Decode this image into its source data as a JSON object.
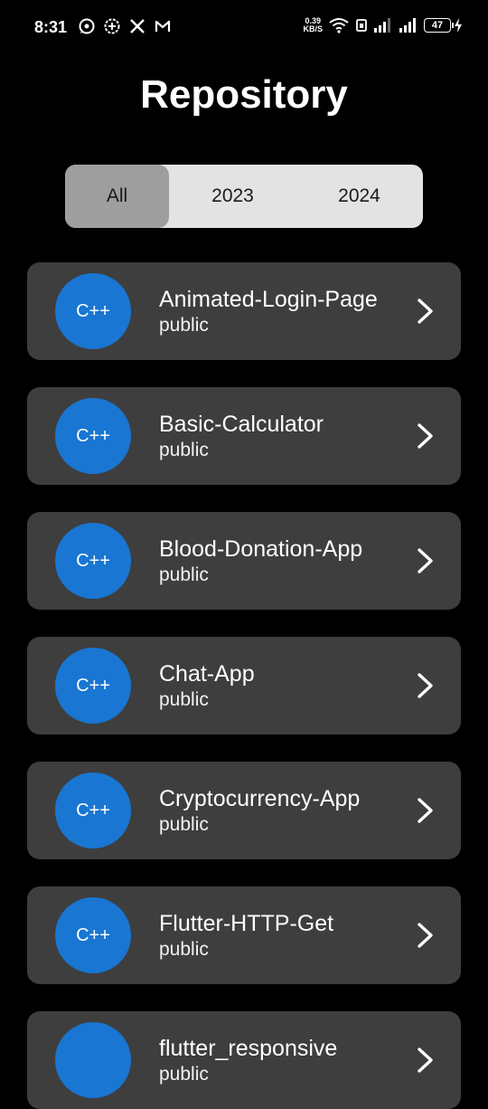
{
  "status_bar": {
    "time": "8:31",
    "notification_icons": [
      "whatsapp-icon",
      "signal-icon",
      "x-icon",
      "gmail-icon"
    ],
    "net_speed_value": "0.39",
    "net_speed_unit": "KB/S",
    "system_icons": [
      "wifi-icon",
      "volte-icon",
      "cellular-signal-1-icon",
      "cellular-signal-2-icon"
    ],
    "battery_level": "47"
  },
  "header": {
    "title": "Repository"
  },
  "filter_tabs": [
    {
      "label": "All",
      "selected": true
    },
    {
      "label": "2023",
      "selected": false
    },
    {
      "label": "2024",
      "selected": false
    }
  ],
  "repositories": [
    {
      "name": "Animated-Login-Page",
      "visibility": "public",
      "language": "C++"
    },
    {
      "name": "Basic-Calculator",
      "visibility": "public",
      "language": "C++"
    },
    {
      "name": "Blood-Donation-App",
      "visibility": "public",
      "language": "C++"
    },
    {
      "name": "Chat-App",
      "visibility": "public",
      "language": "C++"
    },
    {
      "name": "Cryptocurrency-App",
      "visibility": "public",
      "language": "C++"
    },
    {
      "name": "Flutter-HTTP-Get",
      "visibility": "public",
      "language": "C++"
    },
    {
      "name": "flutter_responsive",
      "visibility": "public",
      "language": ""
    }
  ],
  "colors": {
    "background": "#000000",
    "card": "#3e3e3e",
    "avatar": "#1976d2",
    "tab_bar": "#e3e3e3",
    "tab_selected": "#9e9e9e"
  }
}
